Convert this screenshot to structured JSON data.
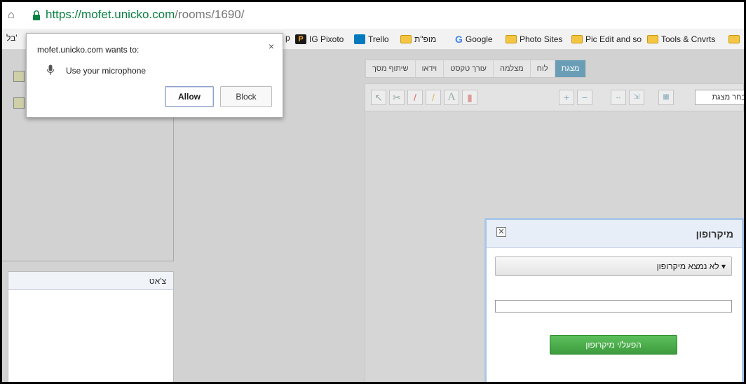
{
  "browser": {
    "url_scheme": "https://",
    "url_host": "mofet.unicko.com",
    "url_path": "/rooms/1690/"
  },
  "bookmarks": {
    "left_cut": "בל'",
    "cut_p": "p",
    "items": [
      {
        "label": "IG Pixoto",
        "icon": "pixoto-icon",
        "color": "#1a1a1a"
      },
      {
        "label": "Trello",
        "icon": "trello-icon",
        "color": "#0079bf"
      },
      {
        "label": "מופ\"ת",
        "icon": "folder-icon"
      },
      {
        "label": "Google",
        "icon": "google-icon"
      },
      {
        "label": "Photo Sites",
        "icon": "folder-icon"
      },
      {
        "label": "Pic Edit and so",
        "icon": "folder-icon"
      },
      {
        "label": "Tools & Cnvrts",
        "icon": "folder-icon"
      }
    ]
  },
  "permission": {
    "message": "mofet.unicko.com wants to:",
    "request": "Use your microphone",
    "allow_label": "Allow",
    "block_label": "Block",
    "close_glyph": "×"
  },
  "app": {
    "tabs": [
      {
        "label": "מצגת",
        "active": true
      },
      {
        "label": "לוח"
      },
      {
        "label": "מצלמה"
      },
      {
        "label": "עורך טקסט"
      },
      {
        "label": "וידאו"
      },
      {
        "label": "שיתוף מסך"
      }
    ],
    "select_presentation": "בחר מצגת",
    "chat_title": "צ'אט"
  },
  "mic_dialog": {
    "title": "מיקרופון",
    "select_value": "▾ לא נמצא מיקרופון",
    "button_label": "הפעל/י מיקרופון",
    "close_glyph": "✕"
  },
  "colors": {
    "tab_active": "#6a9eb6",
    "mic_button": "#4caf50",
    "url_green": "#0b8043"
  }
}
